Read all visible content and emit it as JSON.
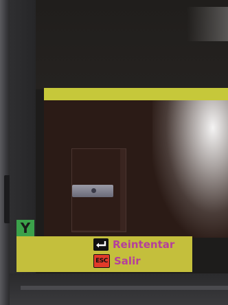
{
  "screen": {
    "badge": "Y",
    "actions": [
      {
        "label": "Reintentar",
        "icon": "enter-key-icon"
      },
      {
        "label": "Salir",
        "icon": "esc-key-icon",
        "key_text": "ESC"
      }
    ]
  },
  "colors": {
    "accent_yellow": "#c4bf3c",
    "label_magenta": "#b53f9c",
    "badge_green": "#3ba14a",
    "esc_red": "#e23a2a"
  }
}
